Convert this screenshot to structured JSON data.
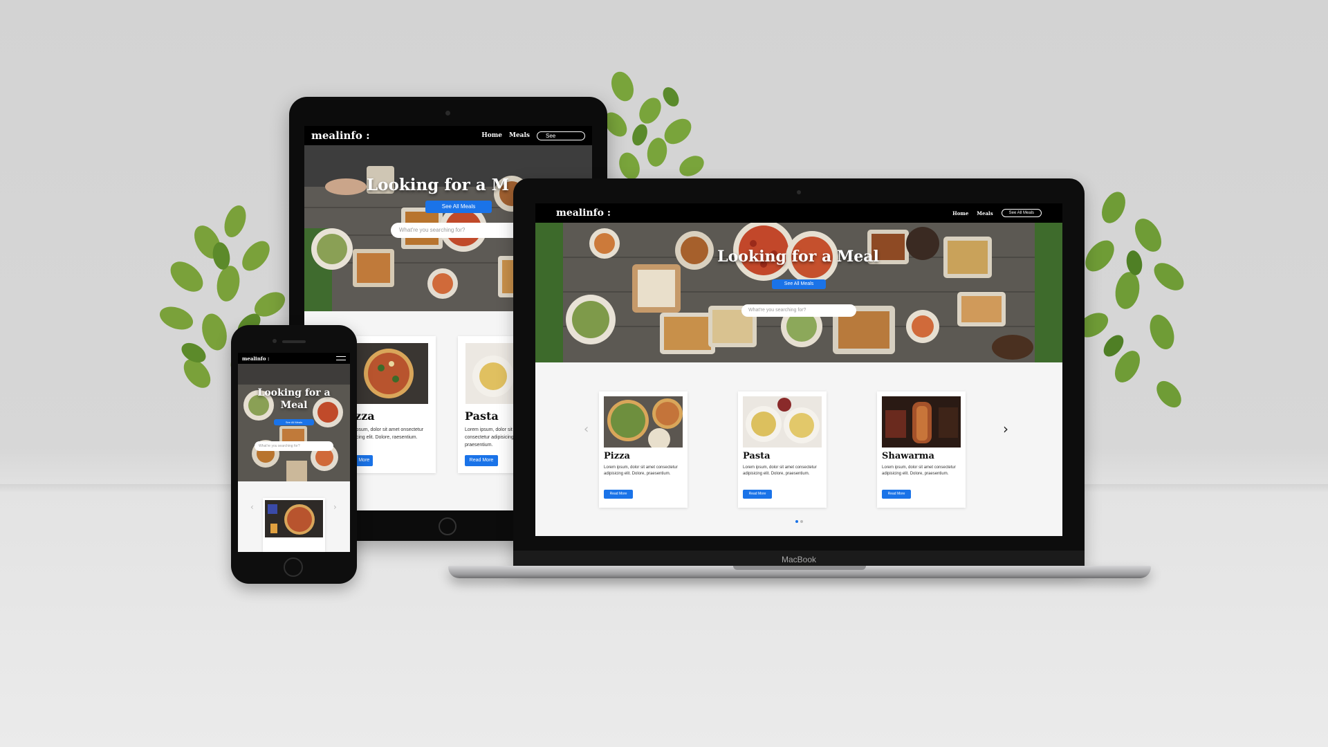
{
  "brand": {
    "logo": "mealinfo :"
  },
  "nav": {
    "home": "Home",
    "meals": "Meals",
    "see_all": "See All Meals",
    "see_short": "See"
  },
  "hero": {
    "title": "Looking for a Meal",
    "title_tablet": "Looking for a M",
    "title_phone_line1": "Looking for a",
    "title_phone_line2": "Meal",
    "button": "See All Meals",
    "search_placeholder": "What're you searching for?"
  },
  "cards": [
    {
      "title": "Pizza",
      "text": "Lorem ipsum, dolor sit amet consectetur adipisicing elit. Dolore, praesentium.",
      "button": "Read More"
    },
    {
      "title": "Pasta",
      "text": "Lorem ipsum, dolor sit amet consectetur adipisicing elit. Dolore, praesentium.",
      "button": "Read More"
    },
    {
      "title": "Shawarma",
      "text": "Lorem ipsum, dolor sit amet consectetur adipisicing elit. Dolore, praesentium.",
      "button": "Read More"
    }
  ],
  "tablet_cards": [
    {
      "title": "Pizza",
      "text": "orem ipsum, dolor sit amet onsectetur adipisicing elit. Dolore, raesentium.",
      "button": "Read More"
    },
    {
      "title": "Pasta",
      "text": "Lorem ipsum, dolor sit amet consectetur adipisicing elit. Dolore, praesentium.",
      "button": "Read More"
    }
  ],
  "laptop": {
    "label": "MacBook"
  },
  "carousel": {
    "prev_icon": "chevron-left-icon",
    "next_icon": "chevron-right-icon",
    "dots": 2,
    "active_dot": 1
  },
  "colors": {
    "accent": "#1a73e8",
    "nav_bg": "#000000",
    "content_bg": "#f5f5f5",
    "wall": "#d5d5d5"
  }
}
